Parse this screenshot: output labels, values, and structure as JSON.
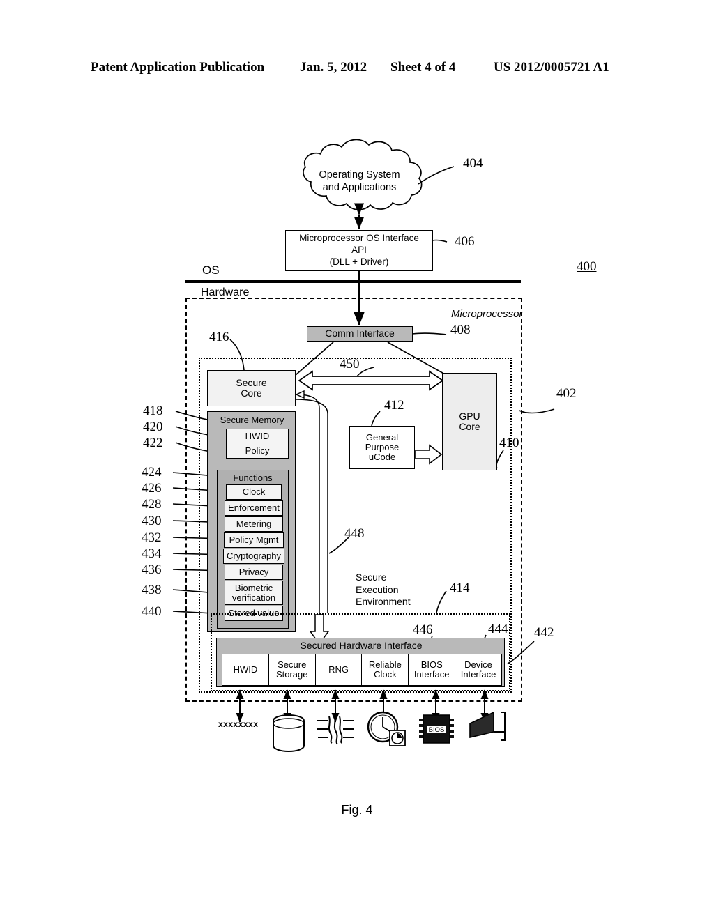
{
  "header": {
    "publication": "Patent Application Publication",
    "date": "Jan. 5, 2012",
    "sheet": "Sheet 4 of 4",
    "number": "US 2012/0005721 A1"
  },
  "figure": {
    "caption": "Fig. 4",
    "system_ref": "400"
  },
  "layers": {
    "os": "OS",
    "hardware": "Hardware"
  },
  "cloud": {
    "line1": "Operating System",
    "line2": "and Applications",
    "ref": "404"
  },
  "api_box": {
    "line1": "Microprocessor OS Interface",
    "line2": "API",
    "line3": "(DLL + Driver)",
    "ref": "406"
  },
  "microprocessor": {
    "label": "Microprocessor",
    "ref": "402"
  },
  "comm_interface": {
    "label": "Comm Interface",
    "ref": "408"
  },
  "bus_ref": "450",
  "secure_core": {
    "line1": "Secure",
    "line2": "Core",
    "ref": "416"
  },
  "secure_memory": {
    "label": "Secure Memory",
    "ref": "418",
    "items": [
      {
        "label": "HWID",
        "ref": "420"
      },
      {
        "label": "Policy",
        "ref": "422"
      }
    ]
  },
  "functions": {
    "label": "Functions",
    "ref": "424",
    "items": [
      {
        "label": "Clock",
        "ref": "426"
      },
      {
        "label": "Enforcement",
        "ref": "428"
      },
      {
        "label": "Metering",
        "ref": "430"
      },
      {
        "label": "Policy Mgmt",
        "ref": "432"
      },
      {
        "label": "Cryptography",
        "ref": "434"
      },
      {
        "label": "Privacy",
        "ref": "436"
      },
      {
        "label": "Biometric verification",
        "ref": "438"
      },
      {
        "label": "Stored value",
        "ref": "440"
      }
    ]
  },
  "ucode": {
    "line1": "General",
    "line2": "Purpose",
    "line3": "uCode",
    "ref": "412"
  },
  "gpu": {
    "line1": "GPU",
    "line2": "Core",
    "ref": "410"
  },
  "secure_execution_environment": {
    "line1": "Secure",
    "line2": "Execution",
    "line3": "Environment",
    "ref": "414",
    "link_ref": "448"
  },
  "secured_hardware_interface": {
    "label": "Secured Hardware Interface",
    "ref": "442",
    "bios_ref": "446",
    "device_ref": "444",
    "cells": [
      {
        "label": "HWID",
        "icon": "hwid-text-icon"
      },
      {
        "label": "Secure Storage",
        "icon": "database-cylinder-icon"
      },
      {
        "label": "RNG",
        "icon": "noise-waveform-icon"
      },
      {
        "label": "Reliable Clock",
        "icon": "clock-icon"
      },
      {
        "label": "BIOS Interface",
        "icon": "bios-chip-icon"
      },
      {
        "label": "Device Interface",
        "icon": "device-icon"
      }
    ]
  },
  "devices": {
    "hwid_serial": "xxxxxxxx",
    "bios_chip_label": "BIOS"
  },
  "colors": {
    "ink": "#000000",
    "shaded_block": "#b9b9b9",
    "functions_block": "#b0b0b0",
    "light_fill": "#f2f2f2",
    "white": "#ffffff"
  }
}
